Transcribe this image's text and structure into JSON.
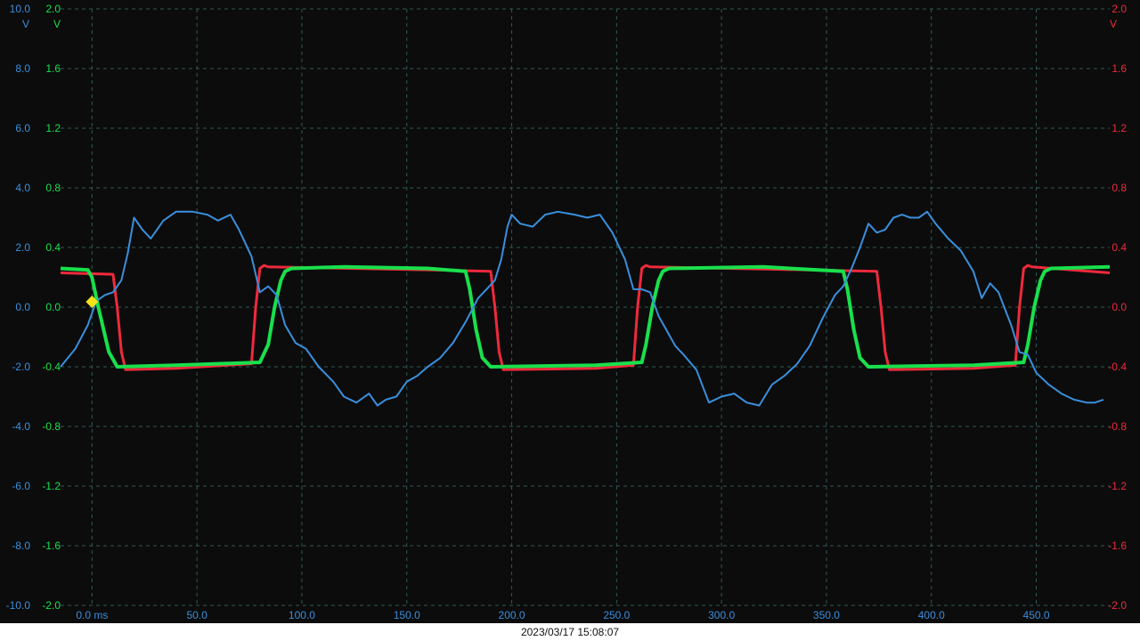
{
  "timestamp": "2023/03/17 15:08:07",
  "axes": {
    "left_blue_unit": "V",
    "left_green_unit": "V",
    "right_red_unit": "V"
  },
  "colors": {
    "background": "#0c0c0c",
    "grid": "#2f5a55",
    "blue": "#3a8fdc",
    "green": "#19e04c",
    "red": "#ef2a3c",
    "trigger": "#f4e21a"
  },
  "chart_data": {
    "type": "line",
    "x_unit": "ms",
    "xlim": [
      -15,
      485
    ],
    "x_ticks": [
      "0.0 ms",
      "50.0",
      "100.0",
      "150.0",
      "200.0",
      "250.0",
      "300.0",
      "350.0",
      "400.0",
      "450.0"
    ],
    "x_tick_values": [
      0,
      50,
      100,
      150,
      200,
      250,
      300,
      350,
      400,
      450
    ],
    "y_left_blue": {
      "ticks": [
        "10.0",
        "8.0",
        "6.0",
        "4.0",
        "2.0",
        "0.0",
        "-2.0",
        "-4.0",
        "-6.0",
        "-8.0",
        "-10.0"
      ],
      "ylim": [
        -10,
        10
      ]
    },
    "y_left_green": {
      "ticks": [
        "2.0",
        "1.6",
        "1.2",
        "0.8",
        "0.4",
        "0.0",
        "-0.4",
        "-0.8",
        "-1.2",
        "-1.6",
        "-2.0"
      ],
      "ylim": [
        -2,
        2
      ]
    },
    "y_right_red": {
      "ticks": [
        "2.0",
        "1.6",
        "1.2",
        "0.8",
        "0.4",
        "0.0",
        "-0.4",
        "-0.8",
        "-1.2",
        "-1.6",
        "-2.0"
      ],
      "ylim": [
        -2,
        2
      ]
    },
    "trigger": {
      "x": 0,
      "y": 0.0
    },
    "series": [
      {
        "color": "#3a8fdc",
        "axis": "blue",
        "x": [
          -15,
          -8,
          -2,
          2,
          6,
          10,
          14,
          17,
          20,
          24,
          28,
          34,
          40,
          48,
          55,
          60,
          66,
          70,
          76,
          80,
          84,
          88,
          92,
          97,
          102,
          108,
          115,
          120,
          126,
          132,
          136,
          140,
          145,
          150,
          155,
          160,
          166,
          172,
          178,
          184,
          188,
          192,
          195,
          198,
          200,
          204,
          210,
          216,
          222,
          230,
          236,
          242,
          248,
          254,
          258,
          262,
          266,
          270,
          274,
          278,
          282,
          288,
          294,
          300,
          306,
          312,
          318,
          324,
          330,
          336,
          342,
          348,
          354,
          358,
          362,
          366,
          370,
          374,
          378,
          382,
          386,
          390,
          394,
          398,
          402,
          408,
          414,
          420,
          424,
          428,
          432,
          438,
          442,
          446,
          450,
          456,
          462,
          468,
          474,
          478,
          482
        ],
        "y": [
          -2.0,
          -1.4,
          -0.6,
          0.2,
          0.4,
          0.5,
          0.9,
          1.8,
          3.0,
          2.6,
          2.3,
          2.9,
          3.2,
          3.2,
          3.1,
          2.9,
          3.1,
          2.6,
          1.7,
          0.5,
          0.7,
          0.4,
          -0.6,
          -1.2,
          -1.4,
          -2.0,
          -2.5,
          -3.0,
          -3.2,
          -2.9,
          -3.3,
          -3.1,
          -3.0,
          -2.5,
          -2.3,
          -2.0,
          -1.7,
          -1.2,
          -0.5,
          0.3,
          0.6,
          0.9,
          1.6,
          2.7,
          3.1,
          2.8,
          2.7,
          3.1,
          3.2,
          3.1,
          3.0,
          3.1,
          2.5,
          1.6,
          0.6,
          0.6,
          0.5,
          -0.3,
          -0.8,
          -1.3,
          -1.6,
          -2.1,
          -3.2,
          -3.0,
          -2.9,
          -3.2,
          -3.3,
          -2.6,
          -2.3,
          -1.9,
          -1.3,
          -0.4,
          0.4,
          0.7,
          1.3,
          2.0,
          2.8,
          2.5,
          2.6,
          3.0,
          3.1,
          3.0,
          3.0,
          3.2,
          2.8,
          2.3,
          1.9,
          1.2,
          0.3,
          0.8,
          0.5,
          -0.6,
          -1.5,
          -1.6,
          -2.2,
          -2.6,
          -2.9,
          -3.1,
          -3.2,
          -3.2,
          -3.1
        ]
      },
      {
        "color": "#19e04c",
        "axis": "green",
        "x": [
          -15,
          -2,
          0,
          3,
          8,
          12,
          40,
          80,
          84,
          87,
          90,
          92,
          95,
          120,
          160,
          178,
          180,
          183,
          186,
          190,
          240,
          262,
          264,
          267,
          270,
          272,
          275,
          320,
          358,
          360,
          363,
          366,
          370,
          420,
          444,
          446,
          449,
          452,
          454,
          457,
          485
        ],
        "y": [
          0.26,
          0.25,
          0.2,
          0.0,
          -0.3,
          -0.4,
          -0.39,
          -0.37,
          -0.25,
          0.0,
          0.18,
          0.24,
          0.26,
          0.27,
          0.26,
          0.24,
          0.12,
          -0.15,
          -0.34,
          -0.4,
          -0.39,
          -0.37,
          -0.25,
          0.0,
          0.18,
          0.24,
          0.26,
          0.27,
          0.24,
          0.12,
          -0.15,
          -0.34,
          -0.4,
          -0.39,
          -0.37,
          -0.25,
          0.0,
          0.18,
          0.24,
          0.26,
          0.27
        ]
      },
      {
        "color": "#ef2a3c",
        "axis": "red",
        "x": [
          -15,
          10,
          12,
          14,
          16,
          40,
          76,
          78,
          80,
          82,
          84,
          160,
          190,
          192,
          194,
          196,
          240,
          258,
          260,
          262,
          264,
          266,
          340,
          374,
          376,
          378,
          380,
          420,
          440,
          442,
          444,
          446,
          448,
          485
        ],
        "y": [
          0.23,
          0.22,
          0.0,
          -0.3,
          -0.42,
          -0.41,
          -0.38,
          0.0,
          0.26,
          0.28,
          0.27,
          0.25,
          0.24,
          0.0,
          -0.3,
          -0.42,
          -0.41,
          -0.39,
          0.0,
          0.26,
          0.28,
          0.27,
          0.25,
          0.24,
          0.0,
          -0.3,
          -0.42,
          -0.41,
          -0.39,
          0.0,
          0.26,
          0.28,
          0.27,
          0.23
        ]
      }
    ]
  }
}
